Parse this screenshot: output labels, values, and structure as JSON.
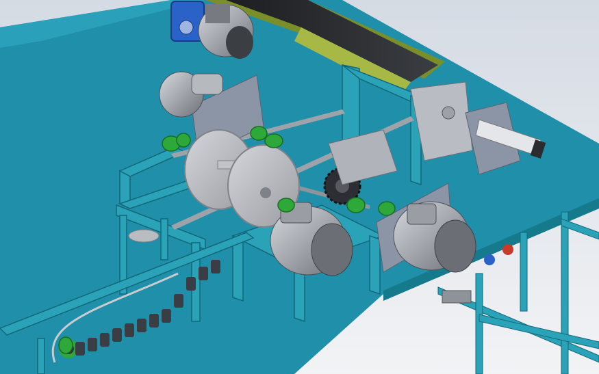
{
  "scene": {
    "description_hidden": "",
    "colors": {
      "background_top": "#d9dee6",
      "background_bottom": "#f3f4f6",
      "table_top": "#1f8faa",
      "table_top_shadow": "#17708a",
      "frame": "#2aa3b8",
      "frame_dark": "#157a8c",
      "motor_body": "#a9adb3",
      "motor_dark": "#5e6268",
      "gearbox_blue": "#2a62c8",
      "belt_black": "#2b2d30",
      "belt_frame": "#7a8f2a",
      "saw_disc": "#b9bcc1",
      "saw_disc_edge": "#8d9096",
      "bearing_green": "#2fa83a",
      "plate_grey": "#8c95a6",
      "chain_dark": "#3a3d44",
      "shaft": "#9ea3aa",
      "red_part": "#c83a2a"
    },
    "icons": [
      "motor-icon",
      "saw-blade-icon",
      "gearbox-icon",
      "bearing-icon",
      "chain-icon",
      "cylinder-icon"
    ]
  }
}
